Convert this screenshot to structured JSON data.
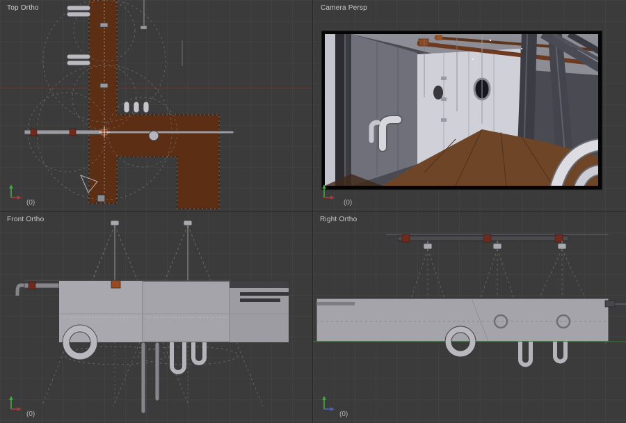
{
  "viewports": {
    "top": {
      "label": "Top Ortho",
      "count": "(0)"
    },
    "camera": {
      "label": "Camera Persp",
      "count": "(0)"
    },
    "front": {
      "label": "Front Ortho",
      "count": "(0)"
    },
    "right": {
      "label": "Right Ortho",
      "count": "(0)"
    }
  },
  "icons": {
    "axis-gizmo": "two perpendicular colored axis arrows",
    "camera-icon": "wireframe triangle frustum with body square",
    "spotlight-icon": "small fixture box with dashed light cone"
  },
  "colors": {
    "viewport-bg": "#3b3b3b",
    "grid-line": "#424242",
    "label-text": "#cccccc",
    "axis-x-red": "#b03a3a",
    "axis-y-green": "#44a844",
    "axis-z-blue": "#4a62c8",
    "x-axis-line-red": "#74302c",
    "ground-line-green": "#2f6b33",
    "floor-brown": "#5c2e13",
    "pipe-gray": "#b4b4ba",
    "wall-gray": "#a4a4aa",
    "coupling-rust": "#6e2b1d",
    "render-floor-brown": "#6e4527",
    "render-wall-white": "#d2d2da",
    "camera-frame-black": "#050505"
  }
}
